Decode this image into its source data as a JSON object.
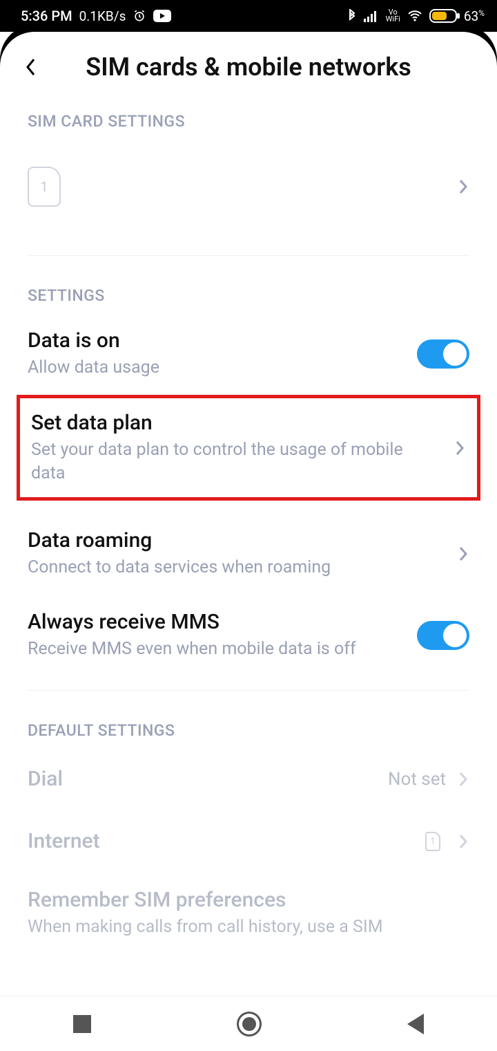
{
  "status": {
    "time": "5:36 PM",
    "net_speed": "0.1KB/s",
    "battery_pct": "63",
    "battery_suffix": "%"
  },
  "header": {
    "title": "SIM cards & mobile networks"
  },
  "sections": {
    "sim": "SIM CARD SETTINGS",
    "settings": "SETTINGS",
    "default": "DEFAULT SETTINGS"
  },
  "sim": {
    "slot1_label": "1"
  },
  "rows": {
    "data": {
      "title": "Data is on",
      "sub": "Allow data usage"
    },
    "plan": {
      "title": "Set data plan",
      "sub": "Set your data plan to control the usage of mobile data"
    },
    "roaming": {
      "title": "Data roaming",
      "sub": "Connect to data services when roaming"
    },
    "mms": {
      "title": "Always receive MMS",
      "sub": "Receive MMS even when mobile data is off"
    },
    "dial": {
      "title": "Dial",
      "value": "Not set"
    },
    "internet": {
      "title": "Internet",
      "value_sim": "1"
    },
    "remember": {
      "title": "Remember SIM preferences",
      "sub": "When making calls from call history, use a SIM"
    }
  }
}
